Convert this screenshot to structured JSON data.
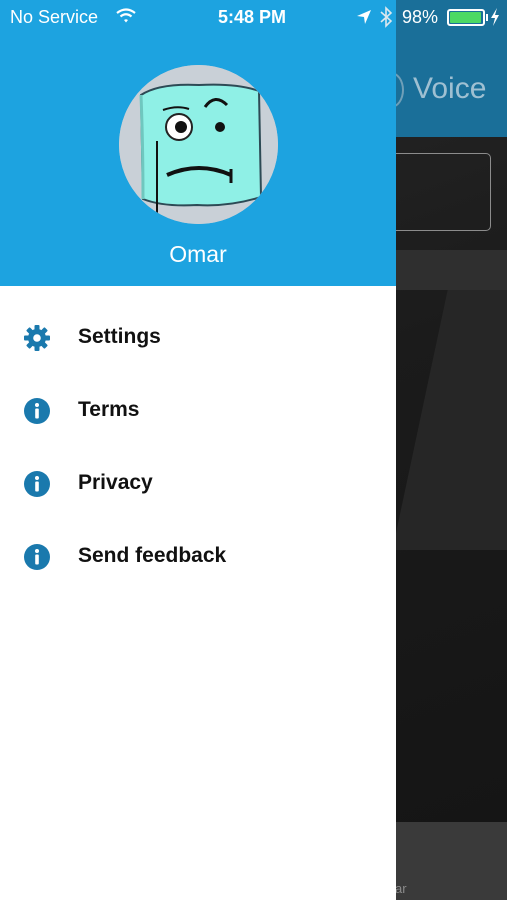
{
  "status_bar": {
    "carrier": "No Service",
    "time": "5:48 PM",
    "battery_percent": "98%",
    "battery_level": 0.98,
    "battery_color": "#4cd964"
  },
  "background_app": {
    "title": "Voice",
    "bottom_label": "ar"
  },
  "drawer": {
    "header_color": "#1da3e0",
    "user_name": "Omar",
    "menu": [
      {
        "label": "Settings",
        "icon": "gear-icon"
      },
      {
        "label": "Terms",
        "icon": "info-icon"
      },
      {
        "label": "Privacy",
        "icon": "info-icon"
      },
      {
        "label": "Send feedback",
        "icon": "info-icon"
      }
    ],
    "icon_color": "#1a79ad"
  }
}
